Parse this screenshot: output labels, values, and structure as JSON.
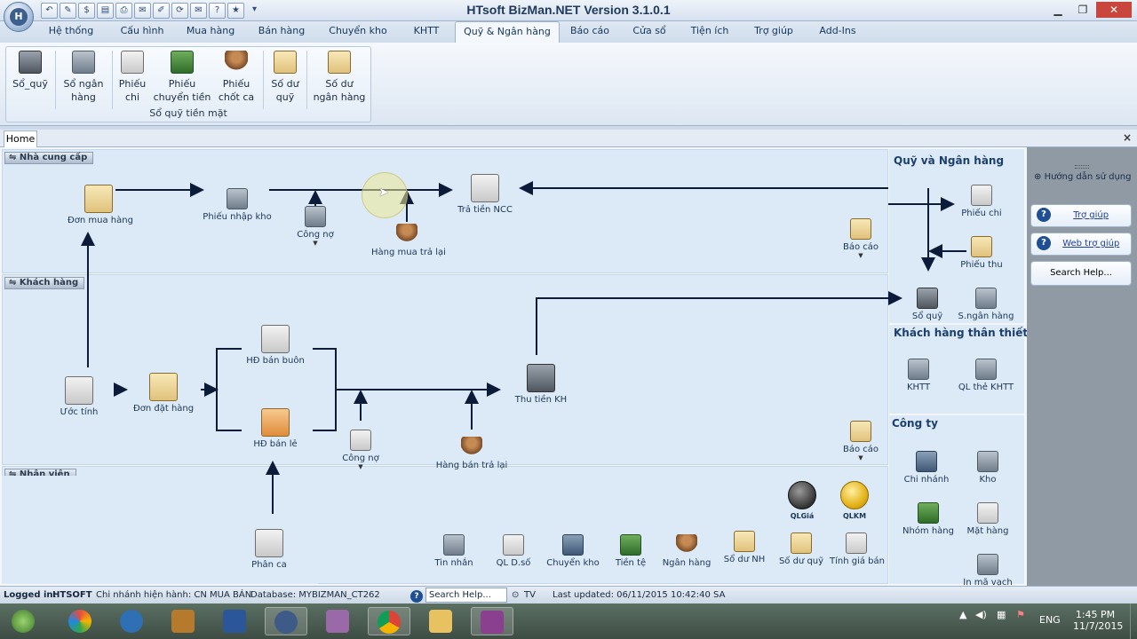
{
  "window": {
    "title": "HTsoft BizMan.NET Version 3.1.0.1"
  },
  "app_menu": {
    "orb_label": "H"
  },
  "quick_access": [
    "back-icon",
    "edit-icon",
    "money-icon",
    "doc-icon",
    "print-icon",
    "mail-icon",
    "pencil-icon",
    "sync-icon",
    "envelope-icon",
    "help-icon",
    "star-icon",
    "more-icon"
  ],
  "tabs": [
    "Hệ thống",
    "Cấu hình",
    "Mua hàng",
    "Bán hàng",
    "Chuyển kho",
    "KHTT",
    "Quỹ & Ngân hàng",
    "Báo cáo",
    "Cửa sổ",
    "Tiện ích",
    "Trợ giúp",
    "Add-Ins"
  ],
  "active_tab": "Quỹ & Ngân hàng",
  "ribbon": {
    "group_label": "Sổ quỹ tiền mặt",
    "buttons": [
      {
        "line1": "Sổ_quỹ",
        "line2": ""
      },
      {
        "line1": "Sổ ngân",
        "line2": "hàng"
      },
      {
        "line1": "Phiếu",
        "line2": "chi"
      },
      {
        "line1": "Phiếu",
        "line2": "chuyển tiền"
      },
      {
        "line1": "Phiếu",
        "line2": "chốt ca"
      },
      {
        "line1": "Số dư",
        "line2": "quỹ"
      },
      {
        "line1": "Số dư",
        "line2": "ngân hàng"
      }
    ]
  },
  "doc_tab": {
    "label": "Home",
    "close": "×"
  },
  "lanes": {
    "supplier": "Nhà cung cấp",
    "customer": "Khách hàng",
    "staff": "Nhân viên"
  },
  "flow": {
    "don_mua_hang": "Đơn mua hàng",
    "phieu_nhap_kho": "Phiếu nhập kho",
    "cong_no_1": "Công nợ",
    "hang_mua_tra_lai": "Hàng mua trả lại",
    "tra_tien_ncc": "Trả tiền NCC",
    "bao_cao_1": "Báo cáo",
    "uoc_tinh": "Ước tính",
    "don_dat_hang": "Đơn đặt hàng",
    "hd_ban_buon": "HĐ bán buôn",
    "hd_ban_le": "HĐ bán lẻ",
    "cong_no_2": "Công nợ",
    "hang_ban_tra_lai": "Hàng bán trả lại",
    "thu_tien_kh": "Thu tiền KH",
    "bao_cao_2": "Báo cáo",
    "phan_ca": "Phân ca",
    "ql_gia": "QLGiá",
    "qlkm": "QLKM"
  },
  "bottom_tools": [
    "Tin nhắn",
    "QL D.số",
    "Chuyển kho",
    "Tiền tệ",
    "Ngân hàng",
    "Sổ dư NH",
    "Số dư quỹ",
    "Tính giá bán"
  ],
  "right_panel": {
    "quy_title": "Quỹ và Ngân hàng",
    "phieu_chi": "Phiếu chi",
    "phieu_thu": "Phiếu thu",
    "so_quy": "Sổ quỹ",
    "s_ngan_hang": "S.ngân hàng",
    "kh_title": "Khách hàng thân thiết",
    "khtt": "KHTT",
    "ql_the_khtt": "QL thẻ KHTT",
    "cty_title": "Công ty",
    "chi_nhanh": "Chi nhánh",
    "kho": "Kho",
    "nhom_hang": "Nhóm hàng",
    "mat_hang": "Mặt hàng",
    "in_ma_vach": "In mã vạch"
  },
  "help_panel": {
    "title": "Hướng dẫn sử dụng",
    "tro_giup": "Trợ giúp",
    "web_tro_giup": "Web trợ giúp",
    "search_help": "Search Help..."
  },
  "status": {
    "logged_in_label": "Logged in:",
    "logged_in_user": "HTSOFT",
    "branch": "Chi nhánh hiện hành: CN MUA BÁN",
    "database": "Database: MYBIZMAN_CT262",
    "search_placeholder": "Search Help...",
    "tv": "TV",
    "last_updated": "Last updated: 06/11/2015 10:42:40 SA"
  },
  "taskbar": {
    "lang": "ENG",
    "time": "1:45 PM",
    "date": "11/7/2015"
  },
  "colors": {
    "lane_bg": "#dceaf8",
    "arrow": "#0d1b3a",
    "title": "#1e395b"
  }
}
